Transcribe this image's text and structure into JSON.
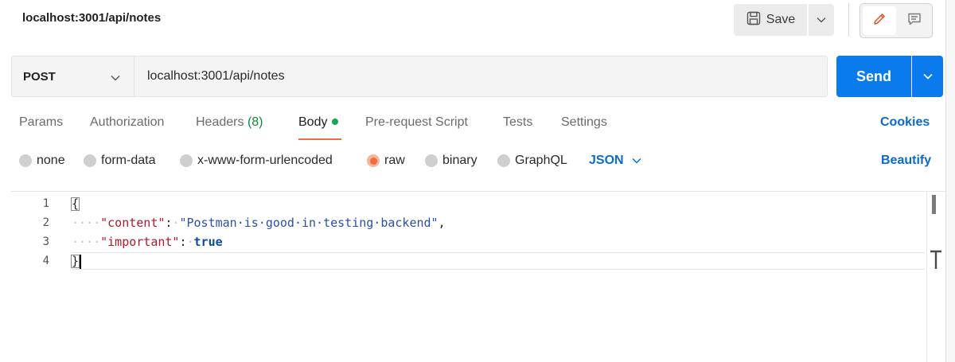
{
  "header": {
    "title": "localhost:3001/api/notes",
    "save_label": "Save"
  },
  "request": {
    "method": "POST",
    "url": "localhost:3001/api/notes",
    "send_label": "Send"
  },
  "tabs": {
    "params": "Params",
    "authorization": "Authorization",
    "headers": "Headers",
    "headers_count": "(8)",
    "body": "Body",
    "prerequest": "Pre-request Script",
    "tests": "Tests",
    "settings": "Settings",
    "cookies": "Cookies"
  },
  "body_options": {
    "none": "none",
    "form_data": "form-data",
    "urlencoded": "x-www-form-urlencoded",
    "raw": "raw",
    "binary": "binary",
    "graphql": "GraphQL",
    "format": "JSON",
    "beautify": "Beautify",
    "selected": "raw"
  },
  "editor": {
    "line_numbers": [
      "1",
      "2",
      "3",
      "4"
    ],
    "open_brace": "{",
    "close_brace": "}",
    "indent": "····",
    "line2_key": "\"content\"",
    "line2_colon": ":",
    "line2_value": "\"Postman·is·good·in·testing·backend\"",
    "line2_comma": ",",
    "line3_key": "\"important\"",
    "line3_colon": ":",
    "line3_value": "true"
  },
  "colors": {
    "accent_blue": "#097bed",
    "active_tab_underline": "#f26b3a",
    "body_dot": "#0fa958",
    "link_blue": "#0b6bcb"
  }
}
